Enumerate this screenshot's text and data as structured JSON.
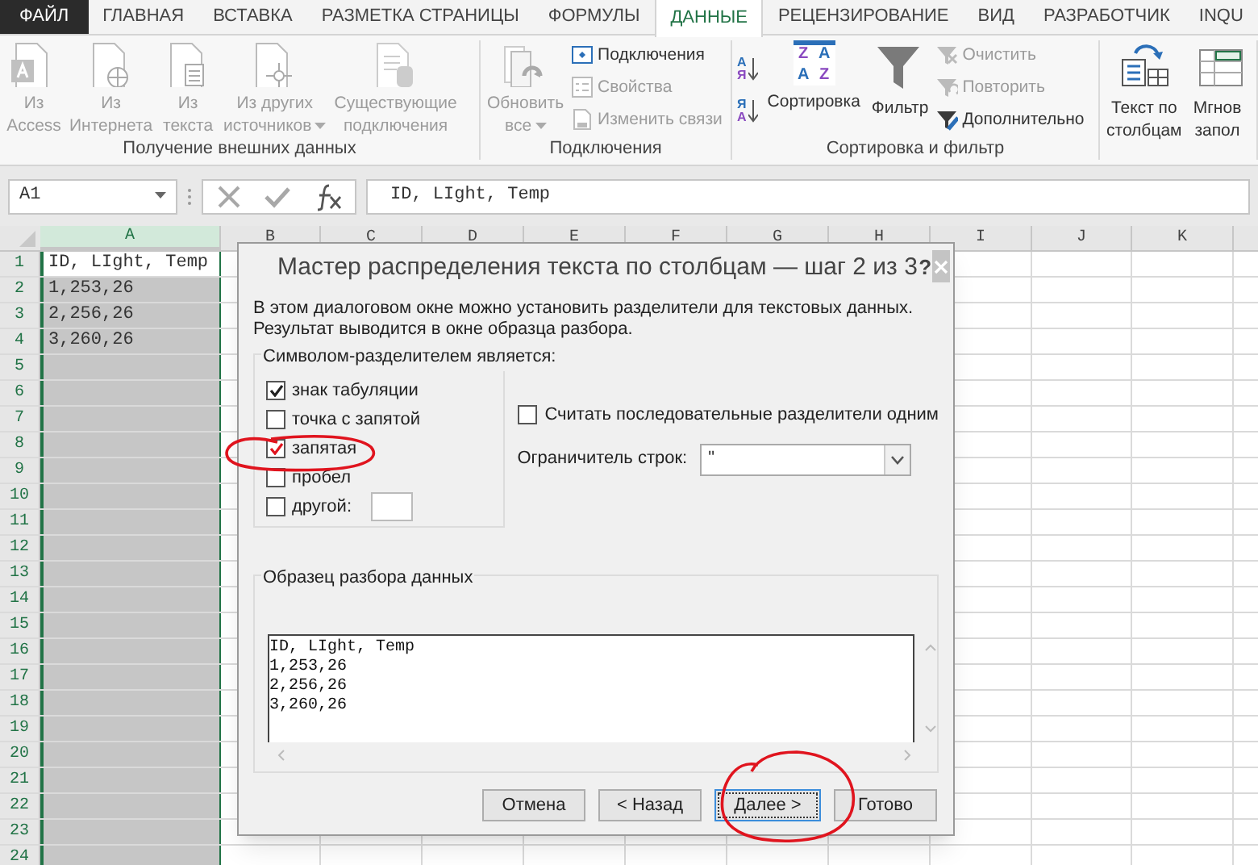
{
  "tabs": [
    {
      "label": "ФАЙЛ",
      "kind": "file",
      "selected": false
    },
    {
      "label": "ГЛАВНАЯ",
      "kind": "tab",
      "selected": false
    },
    {
      "label": "ВСТАВКА",
      "kind": "tab",
      "selected": false
    },
    {
      "label": "РАЗМЕТКА СТРАНИЦЫ",
      "kind": "tab",
      "selected": false
    },
    {
      "label": "ФОРМУЛЫ",
      "kind": "tab",
      "selected": false
    },
    {
      "label": "ДАННЫЕ",
      "kind": "tab",
      "selected": true
    },
    {
      "label": "РЕЦЕНЗИРОВАНИЕ",
      "kind": "tab",
      "selected": false
    },
    {
      "label": "ВИД",
      "kind": "tab",
      "selected": false
    },
    {
      "label": "РАЗРАБОТЧИК",
      "kind": "tab",
      "selected": false
    },
    {
      "label": "INQU",
      "kind": "tab",
      "selected": false
    }
  ],
  "ribbon_groups": [
    {
      "label": "Получение внешних данных",
      "items": [
        {
          "kind": "large",
          "lines": [
            "Из",
            "Access"
          ],
          "disabled": true,
          "dropdown": false
        },
        {
          "kind": "large",
          "lines": [
            "Из",
            "Интернета"
          ],
          "disabled": true,
          "dropdown": false
        },
        {
          "kind": "large",
          "lines": [
            "Из",
            "текста"
          ],
          "disabled": true,
          "dropdown": false
        },
        {
          "kind": "large",
          "lines": [
            "Из других",
            "источников"
          ],
          "disabled": true,
          "dropdown": true
        },
        {
          "kind": "large",
          "lines": [
            "Существующие",
            "подключения"
          ],
          "disabled": true,
          "dropdown": false
        }
      ]
    },
    {
      "label": "Подключения",
      "items": [
        {
          "kind": "large",
          "lines": [
            "Обновить",
            "все"
          ],
          "disabled": true,
          "dropdown": true
        },
        {
          "kind": "small",
          "label": "Подключения",
          "disabled": false
        },
        {
          "kind": "small",
          "label": "Свойства",
          "disabled": true
        },
        {
          "kind": "small",
          "label": "Изменить связи",
          "disabled": true
        }
      ]
    },
    {
      "label": "Сортировка и фильтр",
      "items": [
        {
          "kind": "sort",
          "letters": [
            "А",
            "Я"
          ],
          "disabled": false
        },
        {
          "kind": "sort",
          "letters": [
            "Я",
            "А"
          ],
          "disabled": false
        },
        {
          "kind": "sortgrid",
          "label": "Сортировка",
          "letters": [
            "Z",
            "A",
            "A",
            "Z"
          ],
          "disabled": false
        },
        {
          "kind": "large",
          "lines": [
            "Фильтр"
          ],
          "disabled": false,
          "dropdown": false
        },
        {
          "kind": "small",
          "label": "Очистить",
          "disabled": true
        },
        {
          "kind": "small",
          "label": "Повторить",
          "disabled": true
        },
        {
          "kind": "small",
          "label": "Дополнительно",
          "disabled": false
        }
      ]
    },
    {
      "items": [
        {
          "kind": "large",
          "lines": [
            "Текст по",
            "столбцам"
          ],
          "disabled": false,
          "dropdown": false
        },
        {
          "kind": "large",
          "lines": [
            "Мгнов",
            "запол"
          ],
          "disabled": false,
          "dropdown": false
        }
      ]
    }
  ],
  "formula_bar": {
    "name_box": "A1",
    "formula": "ID, LIght, Temp"
  },
  "sheet": {
    "columns": [
      {
        "label": "A",
        "selected": true
      },
      {
        "label": "B",
        "selected": false
      },
      {
        "label": "C",
        "selected": false
      },
      {
        "label": "D",
        "selected": false
      },
      {
        "label": "E",
        "selected": false
      },
      {
        "label": "F",
        "selected": false
      },
      {
        "label": "G",
        "selected": false
      },
      {
        "label": "H",
        "selected": false
      },
      {
        "label": "I",
        "selected": false
      },
      {
        "label": "J",
        "selected": false
      },
      {
        "label": "K",
        "selected": false
      }
    ],
    "rows": [
      {
        "number": "1",
        "active": true,
        "cells": [
          "ID, LIght, Temp"
        ]
      },
      {
        "number": "2",
        "active": false,
        "cells": [
          "1,253,26"
        ]
      },
      {
        "number": "3",
        "active": false,
        "cells": [
          "2,256,26"
        ]
      },
      {
        "number": "4",
        "active": false,
        "cells": [
          "3,260,26"
        ]
      },
      {
        "number": "5",
        "active": false
      },
      {
        "number": "6",
        "active": false
      },
      {
        "number": "7",
        "active": false
      },
      {
        "number": "8",
        "active": false
      },
      {
        "number": "9",
        "active": false
      },
      {
        "number": "10",
        "active": false
      },
      {
        "number": "11",
        "active": false
      },
      {
        "number": "12",
        "active": false
      },
      {
        "number": "13",
        "active": false
      },
      {
        "number": "14",
        "active": false
      },
      {
        "number": "15",
        "active": false
      },
      {
        "number": "16",
        "active": false
      },
      {
        "number": "17",
        "active": false
      },
      {
        "number": "18",
        "active": false
      },
      {
        "number": "19",
        "active": false
      },
      {
        "number": "20",
        "active": false
      },
      {
        "number": "21",
        "active": false
      },
      {
        "number": "22",
        "active": false
      },
      {
        "number": "23",
        "active": false
      },
      {
        "number": "24",
        "active": false
      }
    ]
  },
  "dialog": {
    "title": "Мастер распределения текста по столбцам — шаг 2 из 3",
    "help": "?",
    "description": "В этом диалоговом окне можно установить разделители для текстовых данных. Результат выводится в окне образца разбора.",
    "delimiters": {
      "legend": "Символом-разделителем является:",
      "options": [
        {
          "label": "знак табуляции",
          "kind": "plain",
          "checked": true
        },
        {
          "label": "точка с запятой",
          "kind": "plain",
          "checked": false
        },
        {
          "label": "запятая",
          "kind": "annotated",
          "checked": true
        },
        {
          "label": "пробел",
          "kind": "plain",
          "checked": false
        },
        {
          "label": "другой:",
          "kind": "other",
          "checked": false
        }
      ]
    },
    "consecutive": {
      "label": "Считать последовательные разделители одним",
      "checked": false
    },
    "text_qualifier": {
      "label": "Ограничитель строк:",
      "value": "\""
    },
    "preview": {
      "legend": "Образец разбора данных",
      "lines": [
        "ID, LIght, Temp",
        "1,253,26",
        "2,256,26",
        "3,260,26"
      ]
    },
    "buttons": [
      {
        "label": "Отмена",
        "focused": false
      },
      {
        "label": "< Назад",
        "focused": false
      },
      {
        "label": "Далее >",
        "focused": true
      },
      {
        "label": "Готово",
        "focused": false
      }
    ]
  }
}
